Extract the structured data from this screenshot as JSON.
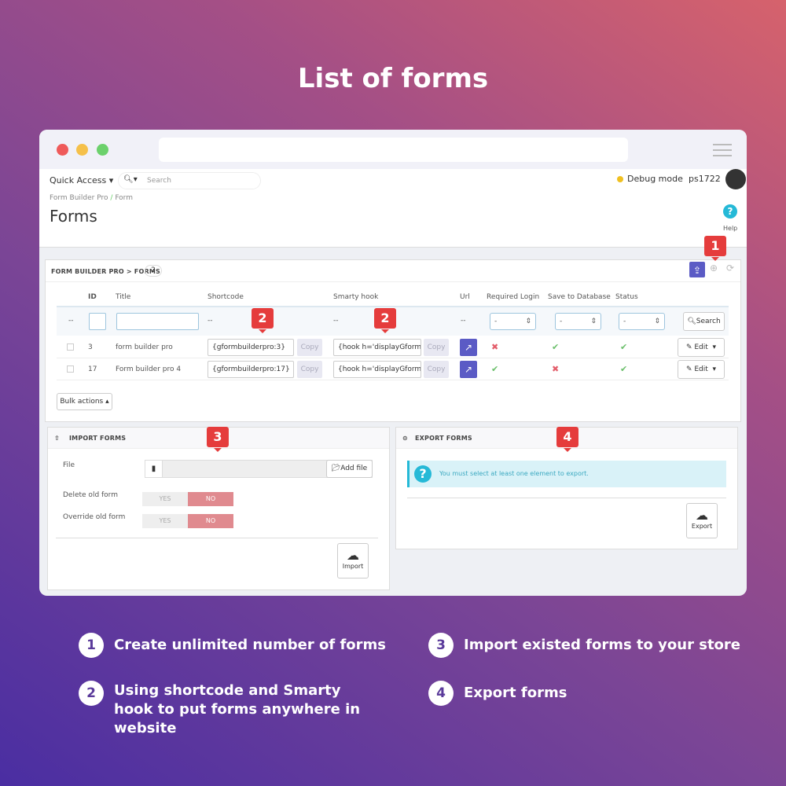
{
  "title": "List of forms",
  "header": {
    "quick_access": "Quick Access ▾",
    "search_placeholder": "Search",
    "debug": "Debug mode",
    "user": "ps1722",
    "breadcrumb": [
      "Form Builder Pro",
      "/",
      "Form"
    ],
    "page_title": "Forms",
    "help": "Help"
  },
  "list": {
    "panel_title": "FORM BUILDER PRO > FORMS",
    "count": "2",
    "columns": [
      "ID",
      "Title",
      "Shortcode",
      "Smarty hook",
      "Url",
      "Required Login",
      "Save to Database",
      "Status"
    ],
    "filter_dash": "--",
    "select_default": "-",
    "search": "Search",
    "rows": [
      {
        "id": "3",
        "title": "form builder pro",
        "shortcode": "{gformbuilderpro:3}",
        "hook": "{hook h='displayGform'",
        "required_login": false,
        "save_db": true,
        "status": true
      },
      {
        "id": "17",
        "title": "Form builder pro 4",
        "shortcode": "{gformbuilderpro:17}",
        "hook": "{hook h='displayGform'",
        "required_login": true,
        "save_db": false,
        "status": true
      }
    ],
    "copy": "Copy",
    "edit": "Edit",
    "bulk": "Bulk actions ▴"
  },
  "import": {
    "title": "IMPORT FORMS",
    "file": "File",
    "add_file": "Add file",
    "delete_old": "Delete old form",
    "override_old": "Override old form",
    "yes": "YES",
    "no": "NO",
    "button": "Import"
  },
  "export": {
    "title": "EXPORT FORMS",
    "notice": "You must select at least one element to export.",
    "button": "Export"
  },
  "callouts": [
    "1",
    "2",
    "3",
    "4"
  ],
  "features": [
    {
      "n": "1",
      "text": "Create unlimited number of forms"
    },
    {
      "n": "2",
      "text": "Using shortcode and Smarty hook to put forms anywhere in website"
    },
    {
      "n": "3",
      "text": "Import existed forms to your store"
    },
    {
      "n": "4",
      "text": "Export forms"
    }
  ],
  "colors": {
    "accent": "#5b5bc5",
    "callout": "#e53c3c",
    "toggle_no": "#e08a8f"
  }
}
